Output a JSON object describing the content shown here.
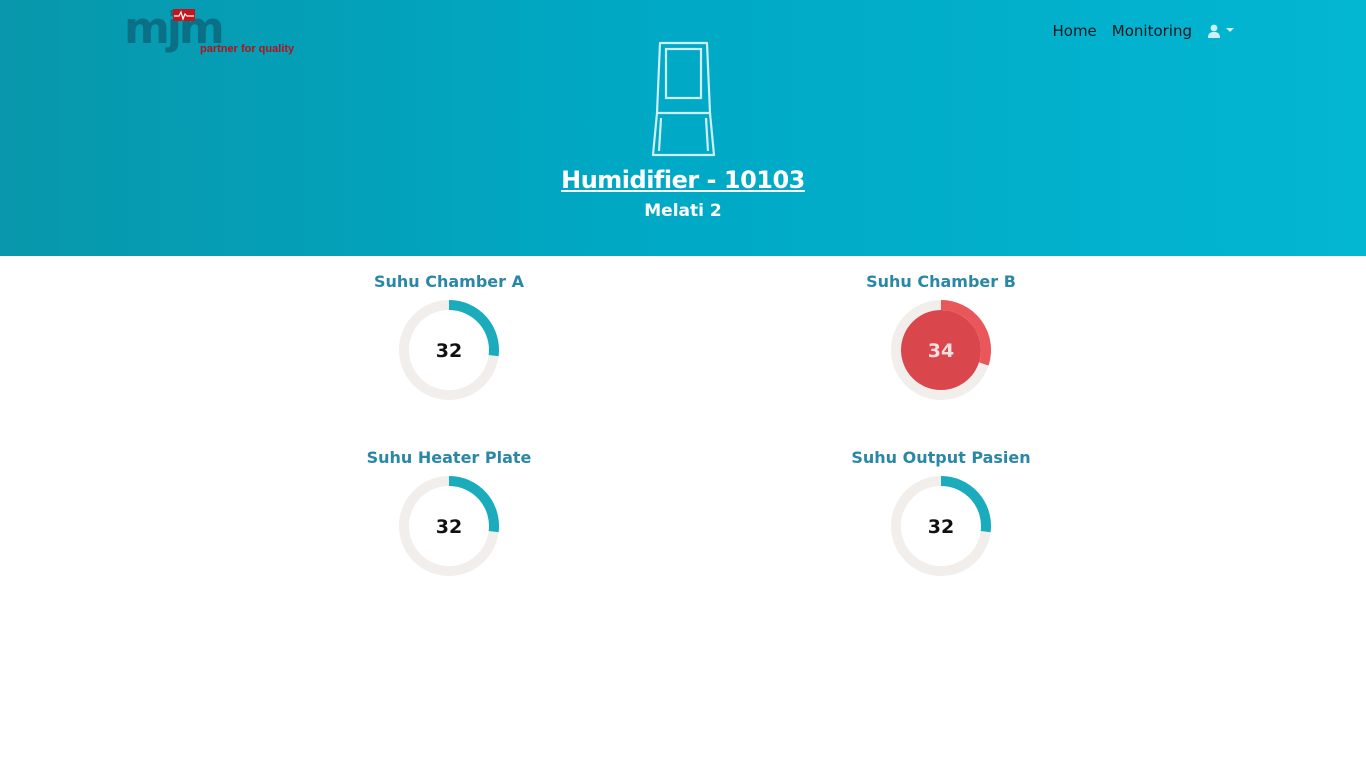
{
  "brand": {
    "logo_letters": "mjm",
    "tagline": "partner for quality"
  },
  "nav": {
    "home_label": "Home",
    "monitoring_label": "Monitoring",
    "user_icon": "user-icon"
  },
  "device": {
    "icon": "humidifier-icon",
    "title": "Humidifier - 10103",
    "location": "Melati 2"
  },
  "gauges": [
    {
      "label": "Suhu Chamber A",
      "value": "32",
      "fill_fraction": 0.27,
      "status": "normal"
    },
    {
      "label": "Suhu Chamber B",
      "value": "34",
      "fill_fraction": 0.3,
      "status": "alert"
    },
    {
      "label": "Suhu Heater Plate",
      "value": "32",
      "fill_fraction": 0.27,
      "status": "normal"
    },
    {
      "label": "Suhu Output Pasien",
      "value": "32",
      "fill_fraction": 0.27,
      "status": "normal"
    }
  ],
  "colors": {
    "header_start": "#0897ab",
    "header_end": "#03b6d2",
    "gauge_track": "#f1eeeb",
    "gauge_normal": "#1aabbd",
    "gauge_alert": "#e9575a",
    "gauge_alert_fill": "#d9474c",
    "label_color": "#2b87a6"
  }
}
